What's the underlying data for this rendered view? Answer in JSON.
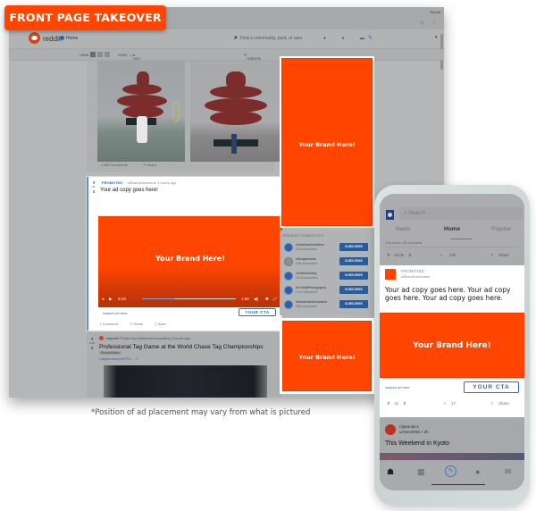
{
  "badge": {
    "label": "FRONT PAGE TAKEOVER"
  },
  "colors": {
    "brand": "#ff4500",
    "link": "#2b6cb0",
    "subscribe": "#2a5c99"
  },
  "desktop": {
    "browser": {
      "tab_label": "Reddit",
      "star_icon": "star-icon",
      "menu_icon": "more-vert-icon"
    },
    "header": {
      "logo_text": "reddit",
      "home_label": "Home",
      "search_placeholder": "Find a community, post, or user",
      "icons": [
        "popular-icon",
        "all-icon",
        "chat-icon",
        "create-post-icon"
      ],
      "user_caret": "▾"
    },
    "subbar": {
      "view_label": "VIEW",
      "sort_label": "SORT",
      "sort_value": "HOT",
      "create_post": "CREATE POST"
    },
    "image_post": {
      "comments": "539 Comments",
      "share": "Share",
      "more": "···"
    },
    "promoted_post": {
      "vote_count": "57",
      "promoted_label": "PROMOTED",
      "meta": "· u/BrandUsername 4 hours ago",
      "ad_copy": "Your ad copy goes here!",
      "brand_text": "Your Brand Here!",
      "video": {
        "current_time": "0:13",
        "duration": "1:00",
        "progress": 0.35
      },
      "url": "custom.url.here",
      "cta": "YOUR CTA",
      "actions": [
        "Comment",
        "Share",
        "Save"
      ]
    },
    "news_post": {
      "vote_count": "6.7k",
      "subreddit": "r/sports",
      "meta": "Posted by u/blckfromaccounting 3 hours ago",
      "title": "Professional Tag Game at the World Chase Tag Championships",
      "flair": "Picture/Video",
      "link": "i.imgur.com/xVbTPs... ↗"
    },
    "sidebar": {
      "ad_top_text": "Your Brand Here!",
      "communities_header": "TRENDING COMMUNITIES",
      "communities": [
        {
          "name": "r/malefashionadvice",
          "subs": "967k subscribers",
          "button": "SUBSCRIBE"
        },
        {
          "name": "r/thingsforants",
          "subs": "184k subscribers",
          "button": "SUBSCRIBE"
        },
        {
          "name": "r/ArtSwimming",
          "subs": "16.7k subscribers",
          "button": "SUBSCRIBE"
        },
        {
          "name": "r/PortraitPhotography",
          "subs": "1.1m subscribers",
          "button": "SUBSCRIBE"
        },
        {
          "name": "r/femalefashionadvice",
          "subs": "926k subscribers",
          "button": "SUBSCRIBE"
        }
      ],
      "ad_bottom_text": "Your Brand Here!"
    }
  },
  "disclaimer": "*Position of ad placement may vary from what is pictured",
  "mobile": {
    "search_placeholder": "Search",
    "tabs": [
      "News",
      "Home",
      "Popular"
    ],
    "active_tab": "Home",
    "prev_post_meta": "4.6k points • 35 comments",
    "prev_actions": {
      "votes": "10.0k",
      "comments": "100",
      "share": "Share"
    },
    "promoted": {
      "label": "PROMOTED",
      "user": "u/BrandUsername",
      "ad_copy": "Your ad copy goes here. Your ad copy goes here. Your ad copy goes here.",
      "brand_text": "Your Brand Here!",
      "url": "custom.url.here",
      "cta": "YOUR CTA",
      "votes": "12",
      "comments": "17",
      "share": "Share"
    },
    "next_post": {
      "subreddit": "r/japanpics",
      "user": "u/SteveR92 • 3h",
      "title": "This Weekend in Kyoto",
      "more": "···"
    },
    "nav_icons": [
      "home-icon",
      "communities-icon",
      "create-icon",
      "chat-icon",
      "inbox-icon"
    ]
  }
}
